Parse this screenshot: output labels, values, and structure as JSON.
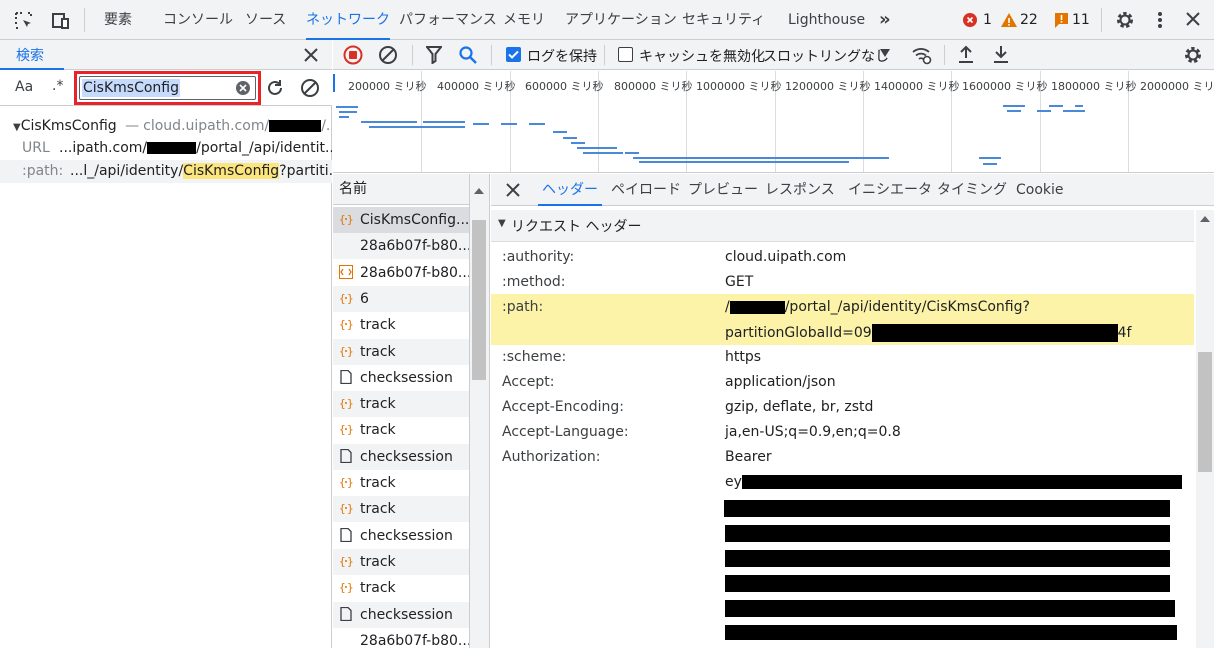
{
  "topbar": {
    "tabs": [
      "要素",
      "コンソール",
      "ソース",
      "ネットワーク",
      "パフォーマンス",
      "メモリ",
      "アプリケーション",
      "セキュリティ",
      "Lighthouse"
    ],
    "more": "»",
    "errors": "1",
    "warnings": "22",
    "issues": "11"
  },
  "search": {
    "title": "検索",
    "case_label": "Aa",
    "regex_label": ".*",
    "query": "CisKmsConfig",
    "results": {
      "file": "CisKmsConfig",
      "file_host": "cloud.uipath.com/",
      "file_tail": "/...",
      "url_label": "URL",
      "url_pre": "...ipath.com/",
      "url_post": "/portal_/api/identit...",
      "path_label": ":path:",
      "path_pre": "...l_/api/identity/",
      "path_match": "CisKmsConfig",
      "path_post": "?partiti..."
    }
  },
  "network_toolbar": {
    "preserve_log": "ログを保持",
    "disable_cache": "キャッシュを無効化",
    "throttle": "スロットリングなし"
  },
  "overview": {
    "ticks": [
      "200000 ミリ秒",
      "400000 ミリ秒",
      "600000 ミリ秒",
      "800000 ミリ秒",
      "1000000 ミリ秒",
      "1200000 ミリ秒",
      "1400000 ミリ秒",
      "1600000 ミリ秒",
      "1800000 ミリ秒",
      "2000000 ミリ秒"
    ]
  },
  "name_column": {
    "header": "名前",
    "rows": [
      {
        "icon": "fetch",
        "name": "CisKmsConfig..."
      },
      {
        "icon": "none",
        "name": "28a6b07f-b80..."
      },
      {
        "icon": "script",
        "name": "28a6b07f-b80..."
      },
      {
        "icon": "fetch",
        "name": "6"
      },
      {
        "icon": "fetch",
        "name": "track"
      },
      {
        "icon": "fetch",
        "name": "track"
      },
      {
        "icon": "doc",
        "name": "checksession"
      },
      {
        "icon": "fetch",
        "name": "track"
      },
      {
        "icon": "fetch",
        "name": "track"
      },
      {
        "icon": "doc",
        "name": "checksession"
      },
      {
        "icon": "fetch",
        "name": "track"
      },
      {
        "icon": "fetch",
        "name": "track"
      },
      {
        "icon": "doc",
        "name": "checksession"
      },
      {
        "icon": "fetch",
        "name": "track"
      },
      {
        "icon": "fetch",
        "name": "track"
      },
      {
        "icon": "doc",
        "name": "checksession"
      },
      {
        "icon": "none",
        "name": "28a6b07f-b80..."
      }
    ]
  },
  "detail": {
    "tabs": [
      "ヘッダー",
      "ペイロード",
      "プレビュー",
      "レスポンス",
      "イニシエータ",
      "タイミング",
      "Cookie"
    ],
    "section_title": "リクエスト ヘッダー",
    "headers": {
      "authority": {
        "name": ":authority:",
        "value": "cloud.uipath.com"
      },
      "method": {
        "name": ":method:",
        "value": "GET"
      },
      "path": {
        "name": ":path:",
        "value_pre": "/",
        "value_post": "/portal_/api/identity/CisKmsConfig?",
        "value_line2_pre": "partitionGlobalId=09",
        "value_line2_post": "4f"
      },
      "scheme": {
        "name": ":scheme:",
        "value": "https"
      },
      "accept": {
        "name": "Accept:",
        "value": "application/json"
      },
      "encoding": {
        "name": "Accept-Encoding:",
        "value": "gzip, deflate, br, zstd"
      },
      "language": {
        "name": "Accept-Language:",
        "value": "ja,en-US;q=0.9,en;q=0.8"
      },
      "authorization": {
        "name": "Authorization:",
        "value": "Bearer",
        "token_prefix": "ey"
      }
    }
  },
  "colors": {
    "accent": "#1a73e8",
    "error": "#d93025",
    "warning": "#e37400",
    "highlight": "#fce57d",
    "search_box_outline": "#e8232a"
  }
}
